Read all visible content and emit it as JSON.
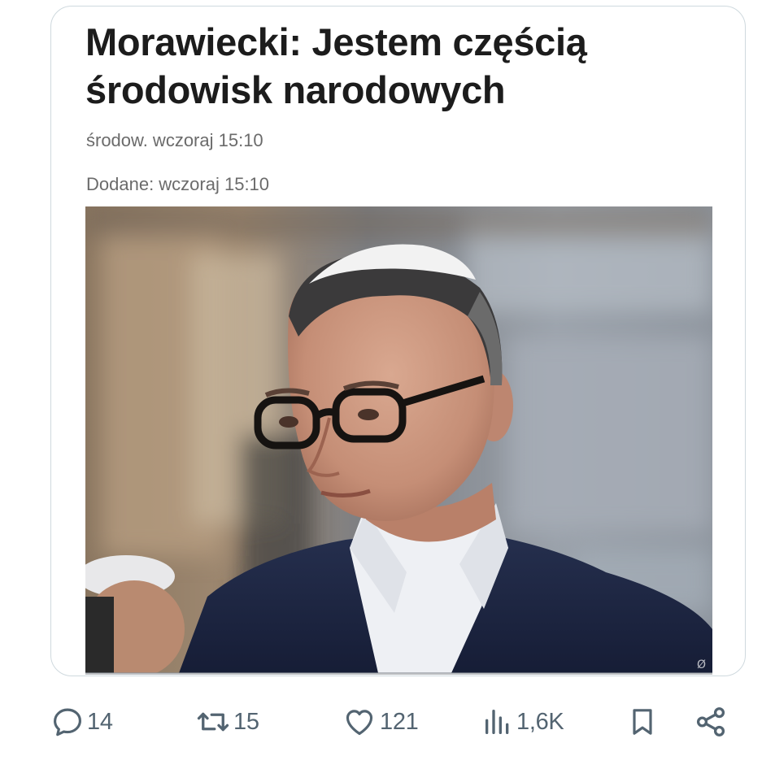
{
  "article": {
    "headline_line1": "Morawiecki: Jestem częścią",
    "headline_line2": "środowisk narodowych",
    "source_line": "środow. wczoraj 15:10",
    "added_line": "Dodane: wczoraj 15:10",
    "photo_icon": "photo-of-man-with-kippah-and-glasses"
  },
  "actions": {
    "reply": {
      "icon": "reply-icon",
      "count": "14"
    },
    "repost": {
      "icon": "repost-icon",
      "count": "15"
    },
    "like": {
      "icon": "heart-icon",
      "count": "121"
    },
    "views": {
      "icon": "views-icon",
      "count": "1,6K"
    },
    "bookmark": {
      "icon": "bookmark-icon"
    },
    "share": {
      "icon": "share-icon"
    }
  },
  "colors": {
    "action_gray": "#536471",
    "card_border": "#cfd9de",
    "headline": "#1c1c1c"
  }
}
